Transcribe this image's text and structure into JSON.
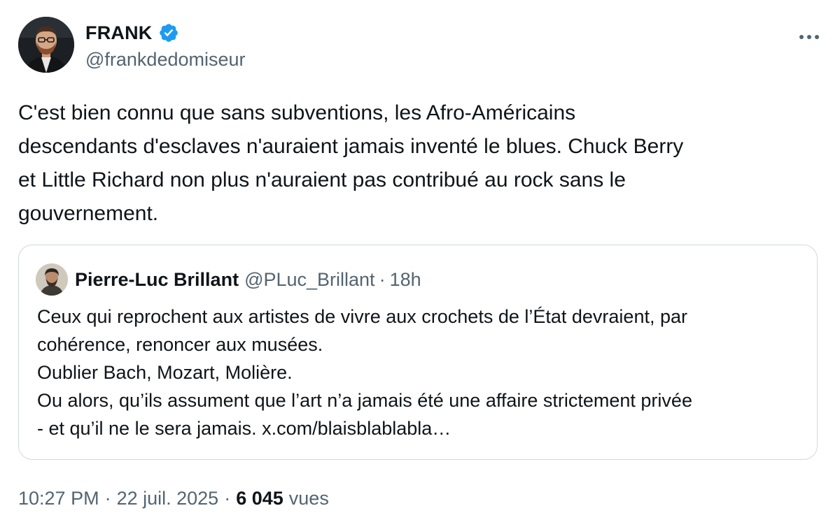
{
  "author": {
    "display_name": "FRANK",
    "handle": "@frankdedomiseur",
    "verified": true,
    "verified_color": "#1d9bf0"
  },
  "tweet": {
    "text": "C'est bien connu que sans subventions, les Afro-Américains\ndescendants d'esclaves n'auraient jamais inventé le blues. Chuck Berry\net Little Richard non plus n'auraient pas contribué au rock sans le\ngouvernement."
  },
  "quoted_tweet": {
    "display_name": "Pierre-Luc Brillant",
    "handle": "@PLuc_Brillant",
    "separator": "·",
    "time": "18h",
    "text": "Ceux qui reprochent aux artistes de vivre aux crochets de l’État devraient, par\ncohérence, renoncer aux musées.\nOublier Bach, Mozart, Molière.\nOu alors, qu’ils assument que l’art n’a jamais été une affaire strictement privée\n- et qu’il ne le sera jamais. x.com/blaisblablabla…"
  },
  "meta": {
    "time": "10:27 PM",
    "separator": "·",
    "date": "22 juil. 2025",
    "views_count": "6 045",
    "views_label": "vues"
  },
  "icons": {
    "more": "more-horizontal-icon",
    "verified": "verified-badge-icon"
  }
}
